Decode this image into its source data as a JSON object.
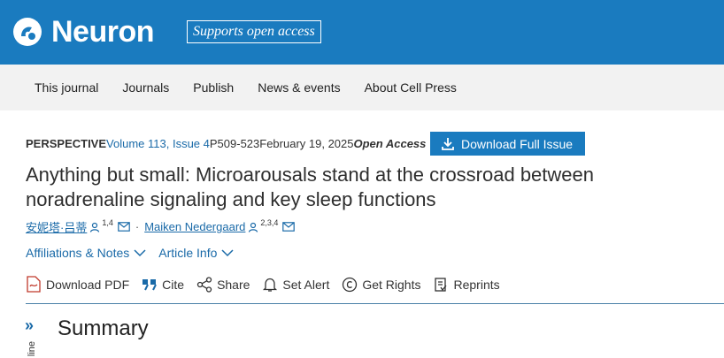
{
  "header": {
    "logo_text": "Neuron",
    "badge": "Supports open access",
    "brand_color": "#1a7bbf"
  },
  "nav": {
    "items": [
      "This journal",
      "Journals",
      "Publish",
      "News & events",
      "About Cell Press"
    ]
  },
  "meta": {
    "type": "PERSPECTIVE",
    "volume": "Volume 113, Issue 4",
    "pages": "P509-523",
    "date": "February 19, 2025",
    "access": "Open Access",
    "download_label": "Download Full Issue"
  },
  "article": {
    "title": "Anything but small: Microarousals stand at the crossroad between noradrenaline signaling and key sleep functions",
    "authors": [
      {
        "name": "安妮塔·吕蒂",
        "sup": "1,4"
      },
      {
        "name": "Maiken Nedergaard",
        "sup": "2,3,4"
      }
    ],
    "separator": "·"
  },
  "links": {
    "affiliations": "Affiliations & Notes",
    "article_info": "Article Info"
  },
  "tools": {
    "download_pdf": "Download PDF",
    "cite": "Cite",
    "share": "Share",
    "set_alert": "Set Alert",
    "get_rights": "Get Rights",
    "reprints": "Reprints"
  },
  "section": {
    "expand": "»",
    "outline": "line",
    "heading": "Summary"
  }
}
